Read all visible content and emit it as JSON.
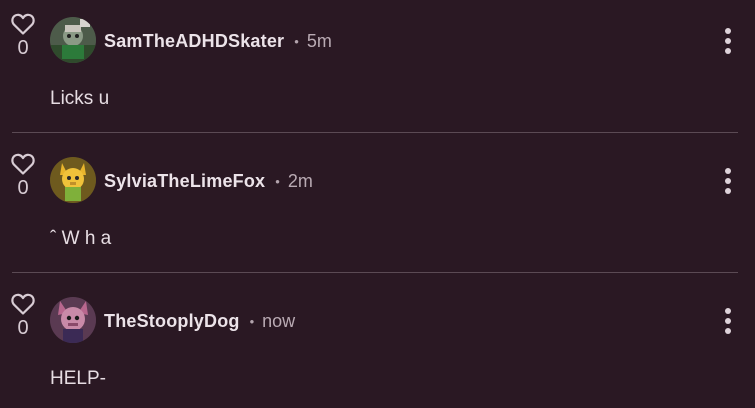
{
  "comments": [
    {
      "likes": "0",
      "username": "SamTheADHDSkater",
      "separator": "•",
      "time": "5m",
      "text": "Licks u",
      "avatar_icon": "skater-avatar"
    },
    {
      "likes": "0",
      "username": "SylviaTheLimeFox",
      "separator": "•",
      "time": "2m",
      "text": "ˆ W h a",
      "avatar_icon": "lime-fox-avatar"
    },
    {
      "likes": "0",
      "username": "TheStooplyDog",
      "separator": "•",
      "time": "now",
      "text": "HELP-",
      "avatar_icon": "dog-avatar"
    }
  ],
  "colors": {
    "background": "#2a1823",
    "divider": "#5b4a54",
    "text": "#e9dfe6"
  }
}
